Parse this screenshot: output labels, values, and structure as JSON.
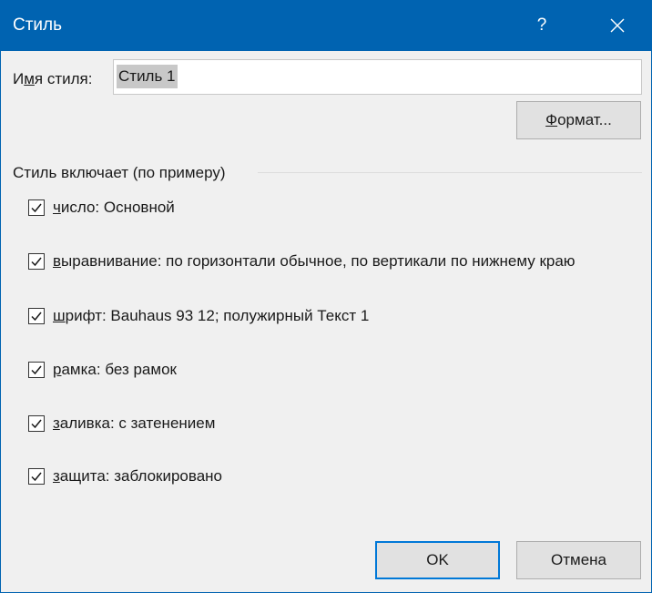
{
  "window": {
    "title": "Стиль",
    "help_label": "?"
  },
  "style_name": {
    "label_prefix": "И",
    "label_accel": "м",
    "label_suffix": "я стиля:",
    "value": "Стиль 1"
  },
  "format_button": {
    "accel": "Ф",
    "rest": "ормат..."
  },
  "group": {
    "label": "Стиль включает (по примеру)"
  },
  "options": [
    {
      "accel": "ч",
      "rest": "исло: Основной",
      "checked": true
    },
    {
      "accel": "в",
      "rest": "ыравнивание: по горизонтали обычное, по вертикали по нижнему краю",
      "checked": true
    },
    {
      "accel": "ш",
      "rest": "рифт: Bauhaus 93 12; полужирный Текст 1",
      "checked": true
    },
    {
      "accel": "р",
      "rest": "амка: без рамок",
      "checked": true
    },
    {
      "accel": "з",
      "rest": "аливка: с затенением",
      "checked": true
    },
    {
      "accel": "з",
      "rest": "ащита: заблокировано",
      "checked": true
    }
  ],
  "buttons": {
    "ok": "OK",
    "cancel": "Отмена"
  },
  "colors": {
    "titlebar": "#0063b1",
    "dialog_bg": "#f0f0f0",
    "button_bg": "#e1e1e1",
    "focus_border": "#0078d7"
  }
}
